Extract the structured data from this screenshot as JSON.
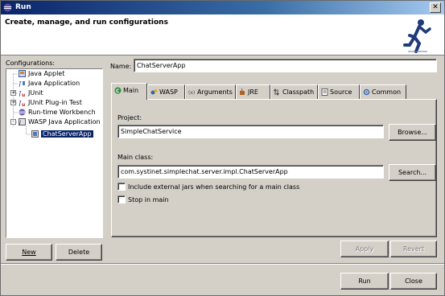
{
  "window": {
    "title": "Run"
  },
  "header": {
    "title": "Create, manage, and run configurations",
    "image_icon": "running-man-icon"
  },
  "configurations": {
    "label": "Configurations:",
    "items": [
      {
        "label": "Java Applet",
        "icon": "java-applet-icon",
        "expander": ""
      },
      {
        "label": "Java Application",
        "icon": "java-application-icon",
        "expander": ""
      },
      {
        "label": "JUnit",
        "icon": "junit-icon",
        "expander": "+"
      },
      {
        "label": "JUnit Plug-in Test",
        "icon": "junit-plugin-icon",
        "expander": "+"
      },
      {
        "label": "Run-time Workbench",
        "icon": "workbench-icon",
        "expander": ""
      },
      {
        "label": "WASP Java Application",
        "icon": "wasp-java-app-icon",
        "expander": "-"
      },
      {
        "label": "ChatServerApp",
        "icon": "config-icon",
        "expander": ""
      }
    ],
    "selected_index": 6
  },
  "name": {
    "label": "Name:",
    "value": "ChatServerApp"
  },
  "tabs": [
    {
      "label": "Main",
      "icon": "main-tab-icon"
    },
    {
      "label": "WASP",
      "icon": "wasp-tab-icon"
    },
    {
      "label": "Arguments",
      "icon": "arguments-tab-icon"
    },
    {
      "label": "JRE",
      "icon": "jre-tab-icon"
    },
    {
      "label": "Classpath",
      "icon": "classpath-tab-icon"
    },
    {
      "label": "Source",
      "icon": "source-tab-icon"
    },
    {
      "label": "Common",
      "icon": "common-tab-icon"
    }
  ],
  "active_tab": "Main",
  "main": {
    "project_label": "Project:",
    "project_value": "SimpleChatService",
    "browse_label": "Browse...",
    "main_class_label": "Main class:",
    "main_class_value": "com.systinet.simplechat.server.impl.ChatServerApp",
    "search_label": "Search...",
    "include_external_label": "Include external jars when searching for a main class",
    "include_external_checked": false,
    "stop_in_main_label": "Stop in main",
    "stop_in_main_checked": false
  },
  "buttons": {
    "new": "New",
    "delete": "Delete",
    "apply": "Apply",
    "revert": "Revert",
    "run": "Run",
    "close": "Close"
  },
  "colors": {
    "title_bar": "#0a246a",
    "selection": "#0a246a",
    "dialog_bg": "#d4d0c8"
  }
}
